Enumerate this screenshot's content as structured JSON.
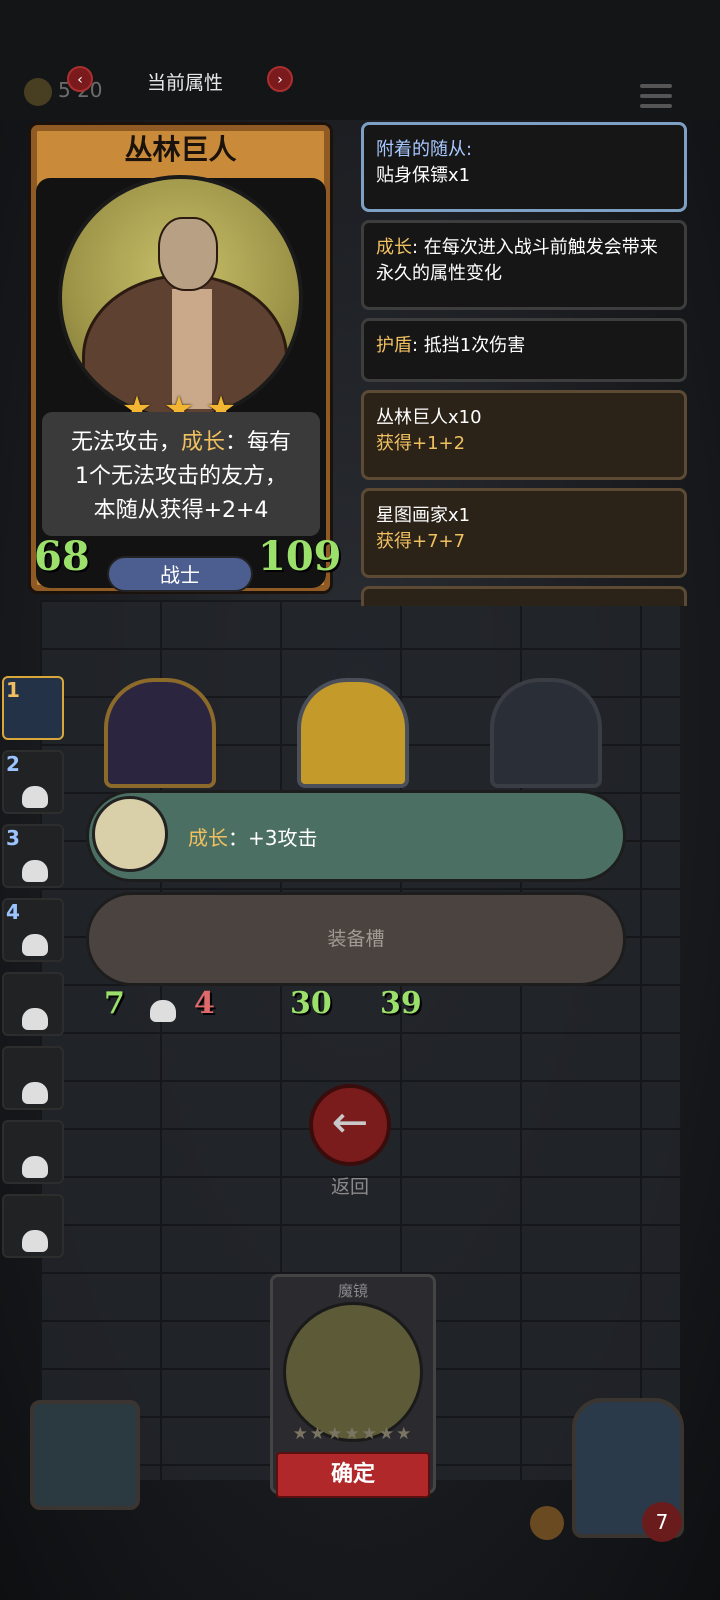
{
  "header": {
    "title": "当前属性",
    "coin_text": "5 20"
  },
  "unit_card": {
    "name": "丛林巨人",
    "stars": [
      "★",
      "★",
      "★"
    ],
    "desc_line1": "无法攻击，",
    "desc_key": "成长",
    "desc_line1b": "：每有",
    "desc_line2": "1个无法攻击的友方，",
    "desc_line3": "本随从获得+2+4",
    "attack": "68",
    "health": "109",
    "class": "战士"
  },
  "panels": [
    {
      "key": "附着的随从:",
      "value": "贴身保镖x1"
    },
    {
      "key": "成长",
      "value": ": 在每次进入战斗前触发会带来永久的属性变化"
    },
    {
      "key": "护盾",
      "value": ": 抵挡1次伤害"
    },
    {
      "title": "丛林巨人x10",
      "bonus": "获得+1+2"
    },
    {
      "title": "星图画家x1",
      "bonus": "获得+7+7"
    }
  ],
  "sidebar": {
    "slots": [
      "1",
      "2",
      "3",
      "4",
      "",
      "",
      "",
      ""
    ]
  },
  "effect": {
    "key": "成长",
    "value": "：+3攻击"
  },
  "equip_slot": "装备槽",
  "board_stats": {
    "left_attack": "7",
    "left_health": "4",
    "mid_attack": "30",
    "mid_health": "39"
  },
  "back": {
    "icon": "←",
    "label": "返回"
  },
  "mirror_card": {
    "name": "魔镜",
    "stars": "★★★★★★★",
    "confirm": "确定"
  },
  "corner": {
    "badge": "7"
  }
}
